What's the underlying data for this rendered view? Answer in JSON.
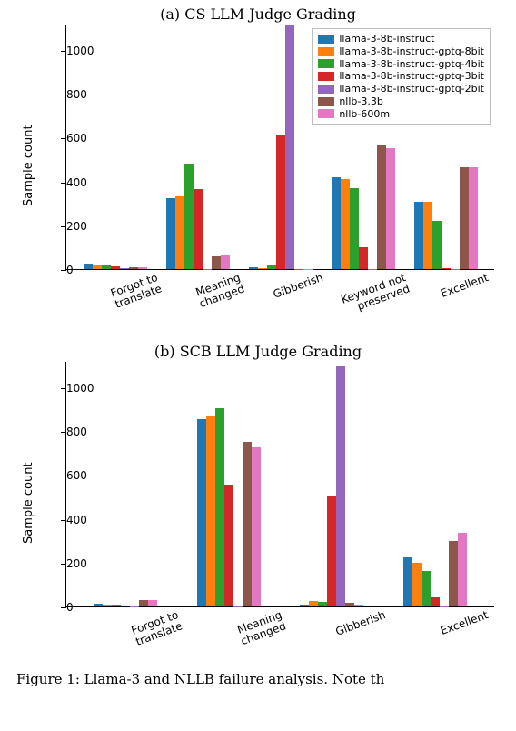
{
  "chart_data": [
    {
      "id": "cs",
      "type": "bar",
      "title": "(a) CS LLM Judge Grading",
      "ylabel": "Sample count",
      "ylim": [
        0,
        1120
      ],
      "y_ticks": [
        0,
        200,
        400,
        600,
        800,
        1000
      ],
      "categories": [
        "Forgot to\ntranslate",
        "Meaning\nchanged",
        "Gibberish",
        "Keyword not\npreserved",
        "Excellent"
      ],
      "series": [
        {
          "name": "llama-3-8b-instruct",
          "color": "#1f77b4",
          "values": [
            25,
            325,
            8,
            420,
            305
          ]
        },
        {
          "name": "llama-3-8b-instruct-gptq-8bit",
          "color": "#ff7f0e",
          "values": [
            22,
            330,
            5,
            410,
            305
          ]
        },
        {
          "name": "llama-3-8b-instruct-gptq-4bit",
          "color": "#2ca02c",
          "values": [
            18,
            480,
            15,
            370,
            220
          ]
        },
        {
          "name": "llama-3-8b-instruct-gptq-3bit",
          "color": "#d62728",
          "values": [
            12,
            365,
            610,
            100,
            5
          ]
        },
        {
          "name": "llama-3-8b-instruct-gptq-2bit",
          "color": "#9467bd",
          "values": [
            5,
            2,
            1110,
            2,
            2
          ]
        },
        {
          "name": "nllb-3.3b",
          "color": "#8c564b",
          "values": [
            8,
            60,
            2,
            565,
            465
          ]
        },
        {
          "name": "nllb-600m",
          "color": "#e377c2",
          "values": [
            10,
            62,
            2,
            550,
            465
          ]
        }
      ],
      "legend_position": "upper-right"
    },
    {
      "id": "scb",
      "type": "bar",
      "title": "(b) SCB LLM Judge Grading",
      "ylabel": "Sample count",
      "ylim": [
        0,
        1120
      ],
      "y_ticks": [
        0,
        200,
        400,
        600,
        800,
        1000
      ],
      "categories": [
        "Forgot to\ntranslate",
        "Meaning\nchanged",
        "Gibberish",
        "Excellent"
      ],
      "series": [
        {
          "name": "llama-3-8b-instruct",
          "color": "#1f77b4",
          "values": [
            12,
            855,
            10,
            225
          ]
        },
        {
          "name": "llama-3-8b-instruct-gptq-8bit",
          "color": "#ff7f0e",
          "values": [
            8,
            870,
            25,
            200
          ]
        },
        {
          "name": "llama-3-8b-instruct-gptq-4bit",
          "color": "#2ca02c",
          "values": [
            10,
            905,
            20,
            160
          ]
        },
        {
          "name": "llama-3-8b-instruct-gptq-3bit",
          "color": "#d62728",
          "values": [
            3,
            555,
            500,
            40
          ]
        },
        {
          "name": "llama-3-8b-instruct-gptq-2bit",
          "color": "#9467bd",
          "values": [
            2,
            2,
            1095,
            2
          ]
        },
        {
          "name": "nllb-3.3b",
          "color": "#8c564b",
          "values": [
            30,
            750,
            18,
            300
          ]
        },
        {
          "name": "nllb-600m",
          "color": "#e377c2",
          "values": [
            28,
            725,
            10,
            335
          ]
        }
      ]
    }
  ],
  "caption_fragment": "Figure 1: Llama-3 and NLLB failure analysis. Note th"
}
